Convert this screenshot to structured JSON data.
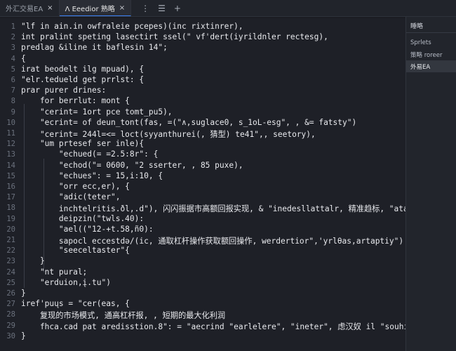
{
  "tabs": [
    {
      "label": "外汇交易EA",
      "close": "×"
    },
    {
      "label": "Λ Eeedior 熟略",
      "close": "×"
    }
  ],
  "tab_actions": [
    "⋮",
    "☰",
    "+"
  ],
  "panel": {
    "title": "睡略",
    "items": [
      "Sprlets",
      "策略 roreer",
      "外易EA"
    ]
  },
  "code_lines": [
    "\"lf in ain.in owfraleie pcepes)(inc rixtinrer),",
    "int pralint speting lasectirt ssel(\" vf'dert(iyrildnler rectesg),",
    "predlag &iline it baflesin 14\";",
    "{",
    "irat beodelt ilg mpuad), {",
    "\"elr.tedueld get prrlst: {",
    "prar purer drines:",
    "    for berrlut: mont {",
    "    \"cerint= 1ort pce tomt_pu5),",
    "    \"ecrint= of deun_tont(fas, =(\"∧,suglace0, s_1oL-esg\", , &= fatsty\")",
    "    \"cerint= 244l=<= loct(syyanthurei(, 猜型) te41\",, seetory),",
    "    \"um prtesef ser inle){",
    "        \"echued(= =2.5:8r\": {",
    "        \"echod(\"= 0600, \"2 sserter, , 85 puxe),",
    "        \"echues\": = 15,i:10, {",
    "        \"orr ecc,er), {",
    "        \"adic(teter\",",
    "        inchtelritis.ðl,.d\"), 闪闪振据市高额回报实现, & \"inedesllattalr, 精准趋标, \"ataliate\"),",
    "        deipzin(\"twls.40):",
    "        \"ael((\"12-+t.58,ñ0):",
    "        sapocl eccestdə/(ic, 通取杠杆操作获取额回操作, werdertior\",'yrlθas,artaptiy\")",
    "        \"seeceltaster\"{",
    "    }",
    "    \"nt pural;",
    "    \"erduion,į.tu\")",
    "}",
    "iref'puųs = \"cer(eas, {",
    "    复现的市场模式, 通高杠杆报, , 短期的最大化利润",
    "    fhca.cad pat aredisstion.8\": = \"aecrind \"earlelere\", \"ineter\", 虑汉奴 il \"souhiner())",
    "}"
  ]
}
